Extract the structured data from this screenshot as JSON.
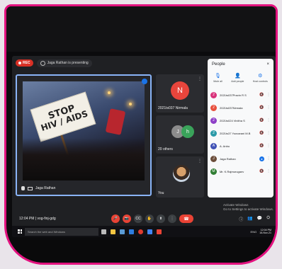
{
  "recording": {
    "label": "REC"
  },
  "presenter_badge": "Jaga Rathan is presenting",
  "presentation": {
    "sign_line1": "STOP",
    "sign_line2": "HIV / AIDS",
    "presenter_name": "Jaga Rathan"
  },
  "side_tiles": [
    {
      "initial": "N",
      "name": "2021ts037 Nirmala",
      "color": "#e8453c"
    },
    {
      "initial_a": "J",
      "initial_b": "h",
      "name": "20 others"
    },
    {
      "name": "You"
    }
  ],
  "people_panel": {
    "title": "People",
    "close": "×",
    "actions": [
      {
        "icon": "🎙",
        "label": "Mute all"
      },
      {
        "icon": "👤",
        "label": "Add people"
      },
      {
        "icon": "⚙",
        "label": "Host controls"
      }
    ],
    "participants": [
      {
        "initial": "2",
        "name": "2021ts037Pravin R S",
        "color": "#d8327a",
        "mic": "🔇",
        "active": false
      },
      {
        "initial": "2",
        "name": "2021ts037Nirmala",
        "color": "#e84f3c",
        "mic": "🔇",
        "active": false
      },
      {
        "initial": "2",
        "name": "2021ts024 Vinitha S",
        "color": "#8e3fc7",
        "mic": "🔇",
        "active": false
      },
      {
        "initial": "2",
        "name": "2021ts37 Yoovarani M.B",
        "color": "#2b9aa8",
        "mic": "🔇",
        "active": false
      },
      {
        "initial": "A",
        "name": "A. Anbu",
        "color": "#3f51b5",
        "mic": "🔇",
        "active": false
      },
      {
        "initial": "J",
        "name": "Jaga Rathan",
        "color": "#6b4d3a",
        "mic": "●",
        "active": true
      },
      {
        "initial": "M",
        "name": "Mr. K.Rajmuruganv",
        "color": "#2f7d32",
        "mic": "🔇",
        "active": false
      }
    ]
  },
  "controls": {
    "time": "12:04 PM | vog-finj-gdg",
    "activate_line1": "Activate Windows",
    "activate_line2": "Go to Settings to activate Windows.",
    "buttons": [
      "🎤",
      "📷",
      "CC",
      "✋",
      "⬆",
      "⋮"
    ],
    "end_call": "☎",
    "right": [
      "ⓘ",
      "👥",
      "💬",
      "⛭"
    ]
  },
  "taskbar": {
    "search_placeholder": "Search the web and Windows",
    "tray_lang": "ENG",
    "clock_time": "12:04 PM",
    "clock_date": "16-Nov-21"
  }
}
